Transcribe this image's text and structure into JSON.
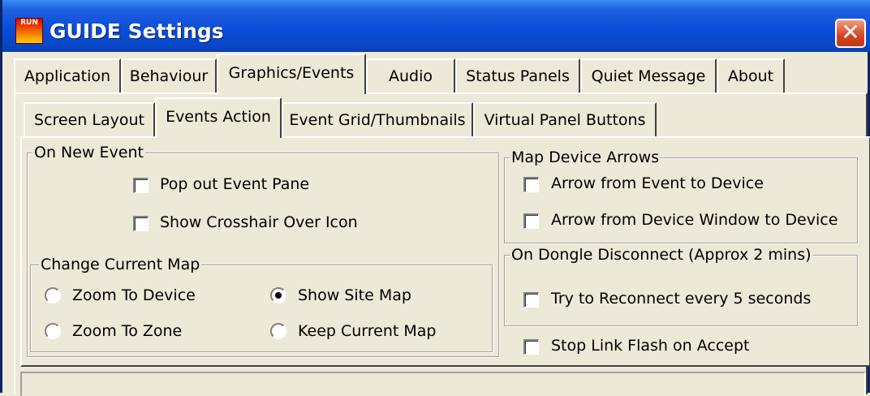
{
  "window": {
    "title": "GUIDE Settings",
    "app_icon_text": "RUN",
    "close_glyph": "✕"
  },
  "main_tabs": [
    "Application",
    "Behaviour",
    "Graphics/Events",
    "Audio",
    "Status Panels",
    "Quiet Message",
    "About"
  ],
  "main_tabs_selected": "Graphics/Events",
  "sub_tabs": [
    "Screen Layout",
    "Events Action",
    "Event Grid/Thumbnails",
    "Virtual Panel Buttons"
  ],
  "sub_tabs_selected": "Events Action",
  "on_new_event": {
    "legend": "On New Event",
    "pop_out_label": "Pop out Event Pane",
    "pop_out_checked": false,
    "crosshair_label": "Show Crosshair Over Icon",
    "crosshair_checked": false
  },
  "change_current_map": {
    "legend": "Change Current Map",
    "options": [
      "Zoom To Device",
      "Show Site Map",
      "Zoom To Zone",
      "Keep Current Map"
    ],
    "selected": "Show Site Map"
  },
  "map_device_arrows": {
    "legend": "Map Device Arrows",
    "event_to_device_label": "Arrow from Event to Device",
    "event_to_device_checked": false,
    "window_to_device_label": "Arrow from Device Window to Device",
    "window_to_device_checked": false
  },
  "dongle": {
    "legend": "On Dongle Disconnect (Approx 2 mins)",
    "reconnect_label": "Try to Reconnect every 5 seconds",
    "reconnect_checked": false
  },
  "stop_link_flash": {
    "label": "Stop Link Flash on Accept",
    "checked": false
  }
}
